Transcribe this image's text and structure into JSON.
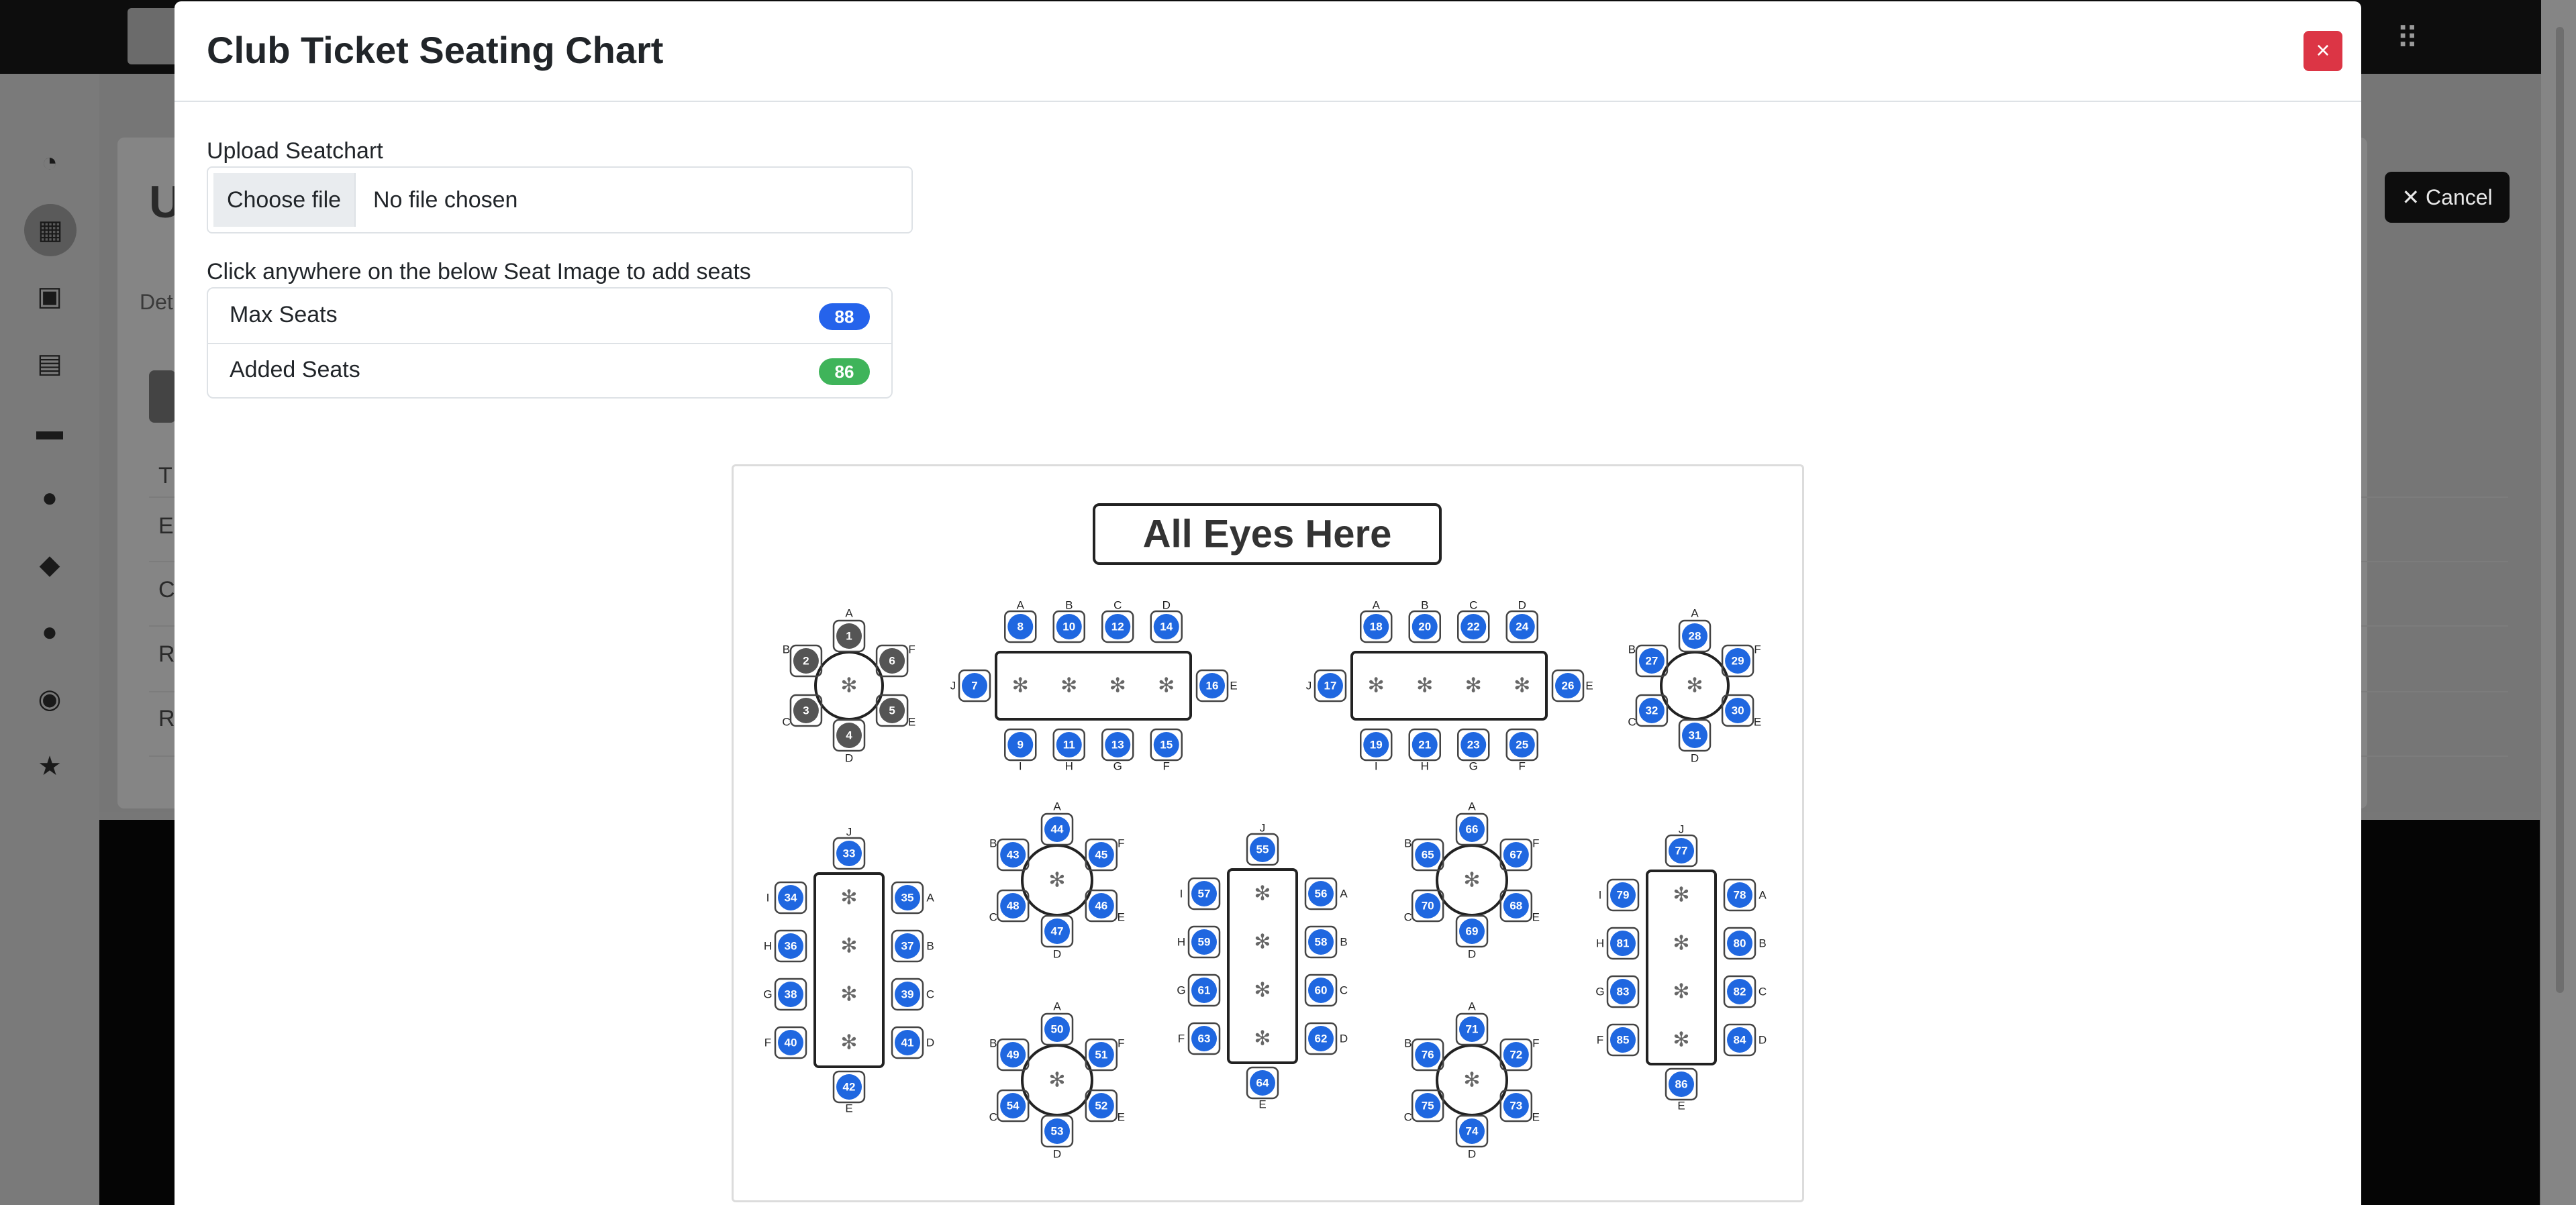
{
  "app": {
    "background_cancel_label": "✕ Cancel",
    "background_heading_partial": "U",
    "background_tab_partial": "Det",
    "background_rows_partial": [
      "E",
      "C",
      "R",
      "R"
    ],
    "background_table_header_partial": "T"
  },
  "modal": {
    "title": "Club Ticket Seating Chart",
    "close_label": "×",
    "upload": {
      "label": "Upload Seatchart",
      "button_label": "Choose file",
      "status_text": "No file chosen"
    },
    "instruction": "Click anywhere on the below Seat Image to add seats",
    "stats": [
      {
        "label": "Max Seats",
        "value": "88",
        "color": "#0d6efd"
      },
      {
        "label": "Added Seats",
        "value": "86",
        "color": "#198754"
      }
    ]
  },
  "seat_image": {
    "title": "All Eyes Here",
    "seat_color_added": "#1f67e0",
    "seat_color_unassigned": "#555555",
    "tables": [
      {
        "shape": "round",
        "letters": [
          "A",
          "B",
          "C",
          "D",
          "E",
          "F"
        ],
        "seats": [
          "1",
          "2",
          "3",
          "4",
          "5",
          "6"
        ],
        "seat_state": "unassigned"
      },
      {
        "shape": "rect",
        "letters_top": [
          "A",
          "B",
          "C",
          "D"
        ],
        "letters_bottom": [
          "I",
          "H",
          "G",
          "F"
        ],
        "letter_left": "J",
        "letter_right": "E",
        "seats_top": [
          "8",
          "10",
          "12",
          "14"
        ],
        "seats_bottom": [
          "9",
          "11",
          "13",
          "15"
        ],
        "seat_left": "7",
        "seat_right": "16"
      },
      {
        "shape": "rect",
        "letters_top": [
          "A",
          "B",
          "C",
          "D"
        ],
        "letters_bottom": [
          "I",
          "H",
          "G",
          "F"
        ],
        "letter_left": "J",
        "letter_right": "E",
        "seats_top": [
          "18",
          "20",
          "22",
          "24"
        ],
        "seats_bottom": [
          "19",
          "21",
          "23",
          "25"
        ],
        "seat_left": "17",
        "seat_right": "26"
      },
      {
        "shape": "round",
        "letters": [
          "A",
          "B",
          "C",
          "D",
          "E",
          "F"
        ],
        "seats": [
          "28",
          "27",
          "32",
          "31",
          "30",
          "29"
        ]
      },
      {
        "shape": "vrect",
        "letters_left": [
          "I",
          "H",
          "G",
          "F"
        ],
        "letters_right": [
          "A",
          "B",
          "C",
          "D"
        ],
        "letter_top": "J",
        "letter_bottom": "E",
        "seats_left": [
          "34",
          "36",
          "38",
          "40"
        ],
        "seats_right": [
          "35",
          "37",
          "39",
          "41"
        ],
        "seat_top": "33",
        "seat_bottom": "42"
      },
      {
        "shape": "round",
        "letters": [
          "A",
          "B",
          "C",
          "D",
          "E",
          "F"
        ],
        "seats": [
          "44",
          "43",
          "48",
          "47",
          "46",
          "45"
        ]
      },
      {
        "shape": "round",
        "letters": [
          "A",
          "B",
          "C",
          "D",
          "E",
          "F"
        ],
        "seats": [
          "50",
          "49",
          "54",
          "53",
          "52",
          "51"
        ]
      },
      {
        "shape": "vrect",
        "letters_left": [
          "I",
          "H",
          "G",
          "F"
        ],
        "letters_right": [
          "A",
          "B",
          "C",
          "D"
        ],
        "letter_top": "J",
        "letter_bottom": "E",
        "seats_left": [
          "57",
          "59",
          "61",
          "63"
        ],
        "seats_right": [
          "56",
          "58",
          "60",
          "62"
        ],
        "seat_top": "55",
        "seat_bottom": "64"
      },
      {
        "shape": "round",
        "letters": [
          "A",
          "B",
          "C",
          "D",
          "E",
          "F"
        ],
        "seats": [
          "66",
          "65",
          "70",
          "69",
          "68",
          "67"
        ]
      },
      {
        "shape": "round",
        "letters": [
          "A",
          "B",
          "C",
          "D",
          "E",
          "F"
        ],
        "seats": [
          "71",
          "76",
          "75",
          "74",
          "73",
          "72"
        ]
      },
      {
        "shape": "vrect",
        "letters_left": [
          "I",
          "H",
          "G",
          "F"
        ],
        "letters_right": [
          "A",
          "B",
          "C",
          "D"
        ],
        "letter_top": "J",
        "letter_bottom": "E",
        "seats_left": [
          "79",
          "81",
          "83",
          "85"
        ],
        "seats_right": [
          "78",
          "80",
          "82",
          "84"
        ],
        "seat_top": "77",
        "seat_bottom": "86"
      }
    ]
  }
}
